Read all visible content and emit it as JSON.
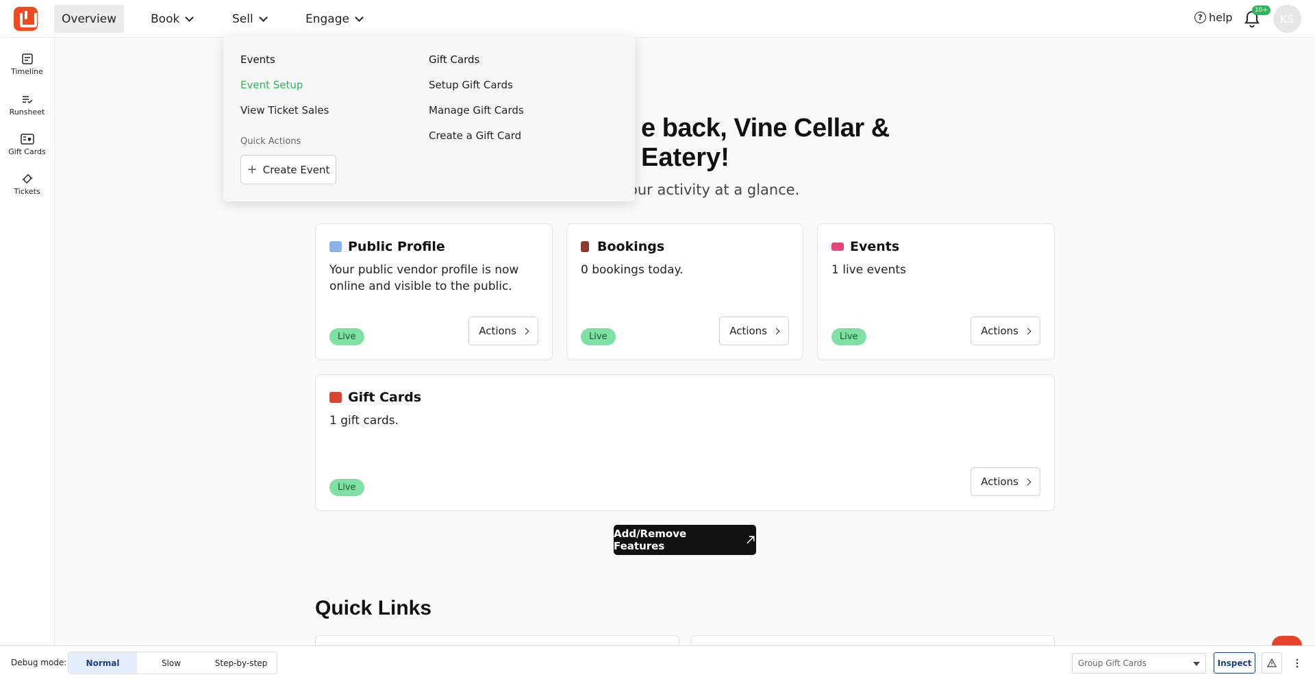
{
  "nav": {
    "overview": "Overview",
    "book": "Book",
    "sell": "Sell",
    "engage": "Engage",
    "help": "help",
    "notification_badge": "10+",
    "avatar_initials": "KS"
  },
  "sidebar": {
    "items": [
      {
        "label": "Timeline",
        "icon": "timeline-icon"
      },
      {
        "label": "Runsheet",
        "icon": "runsheet-icon"
      },
      {
        "label": "Gift Cards",
        "icon": "gift-cards-icon"
      },
      {
        "label": "Tickets",
        "icon": "tickets-icon"
      }
    ]
  },
  "main": {
    "welcome_line1": "e back, Vine Cellar &",
    "welcome_line2": "Eatery!",
    "subtitle": "our activity at a glance.",
    "cards": [
      {
        "title": "Public Profile",
        "text": "Your public vendor profile is now online and visible to the public.",
        "status": "Live",
        "action": "Actions",
        "emoji_color": "#8ab4e8"
      },
      {
        "title": "Bookings",
        "text": "0 bookings today.",
        "status": "Live",
        "action": "Actions",
        "emoji_color": "#8a3b2e"
      },
      {
        "title": "Events",
        "text": "1 live events",
        "status": "Live",
        "action": "Actions",
        "emoji_color": "#e8437a"
      },
      {
        "title": "Gift Cards",
        "text": "1 gift cards.",
        "status": "Live",
        "action": "Actions",
        "emoji_color": "#d9442e"
      }
    ],
    "features_button": "Add/Remove Features",
    "quick_links_title": "Quick Links"
  },
  "dropdown": {
    "events_heading": "Events",
    "event_setup": "Event Setup",
    "view_ticket_sales": "View Ticket Sales",
    "quick_actions": "Quick Actions",
    "create_event": "Create Event",
    "gift_cards_heading": "Gift Cards",
    "setup_gift_cards": "Setup Gift Cards",
    "manage_gift_cards": "Manage Gift Cards",
    "create_gift_card": "Create a Gift Card"
  },
  "debug": {
    "label": "Debug mode:",
    "modes": [
      "Normal",
      "Slow",
      "Step-by-step"
    ],
    "selected_mode": "Normal",
    "select_value": "Group Gift Cards",
    "inspect": "Inspect"
  },
  "colors": {
    "brand": "#f04a23",
    "live_green": "#7ee0a3",
    "link_green": "#2fb45c",
    "debug_blue": "#1a3d8f"
  }
}
